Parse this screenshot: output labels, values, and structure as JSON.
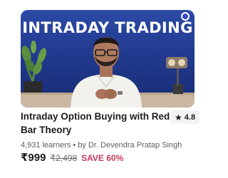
{
  "thumbnail": {
    "headline": "INTRADAY TRADING",
    "logo_icon": "brand-logo-icon"
  },
  "course": {
    "title": "Intraday Option Buying with Red Bar Theory",
    "rating": "4.8",
    "rating_icon": "star-icon",
    "learners": "4,931 learners",
    "separator": "•",
    "instructor": "by Dr. Devendra Pratap Singh"
  },
  "pricing": {
    "current": "₹999",
    "original": "₹2,498",
    "discount": "SAVE 60%"
  },
  "colors": {
    "thumbnail_bg": "#20378a",
    "discount": "#c73a5a",
    "text": "#1c1d1f"
  }
}
